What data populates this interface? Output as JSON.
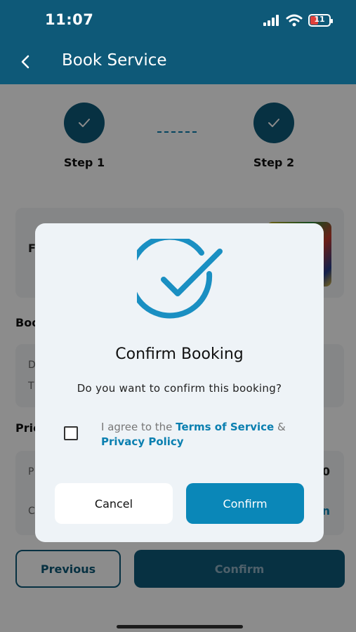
{
  "status_bar": {
    "time": "11:07",
    "battery": "11"
  },
  "app_bar": {
    "title": "Book Service"
  },
  "steps": [
    {
      "label": "Step 1",
      "completed": true
    },
    {
      "label": "Step 2",
      "completed": true
    }
  ],
  "background": {
    "service_card_text": "F",
    "booking_section_label": "Boo",
    "booking_line_1": "D",
    "booking_line_2": "T",
    "price_section_label": "Pric",
    "price_line_1": "P",
    "price_line_1_value": "0",
    "price_line_2": "C",
    "price_line_2_value": "n"
  },
  "footer": {
    "previous_label": "Previous",
    "confirm_label": "Confirm"
  },
  "dialog": {
    "icon": "check-circle-icon",
    "title": "Confirm Booking",
    "message": "Do you want to confirm this booking?",
    "agree_prefix": "I agree to the",
    "terms_link": "Terms of Service",
    "ampersand": "&",
    "privacy_link": "Privacy Policy",
    "checkbox_checked": false,
    "cancel_label": "Cancel",
    "confirm_label": "Confirm"
  },
  "colors": {
    "brand": "#0e5978",
    "accent": "#0a87b8",
    "dialog_bg": "#eef3f7"
  }
}
